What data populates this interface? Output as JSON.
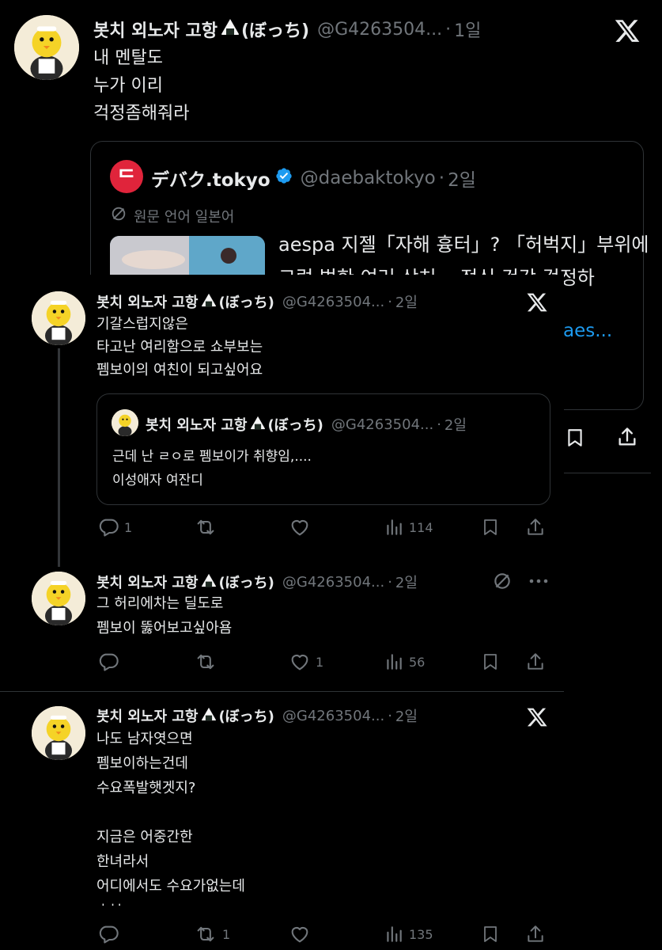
{
  "main_tweet": {
    "author_name": "봇치 외노자 고항",
    "author_suffix": "(ぼっち)",
    "handle": "@G4263504...",
    "time": "1일",
    "text": "내 멘탈도\n누가 이리\n걱정좀해줘라",
    "quoted": {
      "brand_initial": "ᄃ",
      "author_name": "デバク.tokyo",
      "handle": "@daebaktokyo",
      "time": "2일",
      "translate_note": "원문 언어 일본어",
      "headline_line1": "aespa 지젤「자해 흉터」? 「허벅지」부위에",
      "headline_line2": "그럼 벌한 여러 상처... 정신 건강 걱정하",
      "link_fragment": "aes..."
    }
  },
  "thread": [
    {
      "author_name": "봇치 외노자 고항",
      "author_suffix": "(ぼっち)",
      "handle": "@G4263504...",
      "time": "2일",
      "text": "기갈스럽지않은\n타고난 여리함으로 쇼부보는\n펨보이의 여친이 되고싶어요",
      "quoted": {
        "author_name": "봇치 외노자 고항",
        "author_suffix": "(ぼっち)",
        "handle": "@G4263504...",
        "time": "2일",
        "text": "근데 난 ㄹㅇ로 펨보이가 취향임,....\n이성애자 여잔디"
      },
      "actions": {
        "replies": "1",
        "retweets": "",
        "likes": "",
        "views": "114"
      }
    },
    {
      "author_name": "봇치 외노자 고항",
      "author_suffix": "(ぼっち)",
      "handle": "@G4263504...",
      "time": "2일",
      "text": "그 허리에차는 딜도로\n펨보이 뚫어보고싶아욤",
      "actions": {
        "replies": "",
        "retweets": "",
        "likes": "1",
        "views": "56"
      }
    },
    {
      "author_name": "봇치 외노자 고항",
      "author_suffix": "(ぼっち)",
      "handle": "@G4263504...",
      "time": "2일",
      "text": "나도 남자엿으면\n펨보이하는건데\n수요폭발햇겟지?\n\n지금은 어중간한\n한녀라서\n어디에서도 수요가없는데",
      "cut_text": "ㅅㅂ",
      "actions": {
        "replies": "",
        "retweets": "1",
        "likes": "",
        "views": "135"
      }
    }
  ],
  "colors": {
    "background": "#000000",
    "text": "#e7e9ea",
    "muted": "#71767b",
    "border": "#2f3336",
    "verified": "#1d9bf0",
    "brand_red": "#e0243b"
  },
  "icons": [
    "x-logo-icon",
    "verified-badge-icon",
    "translate-icon",
    "reply-icon",
    "retweet-icon",
    "like-icon",
    "views-icon",
    "bookmark-icon",
    "share-icon",
    "more-icon",
    "riceball-icon"
  ]
}
